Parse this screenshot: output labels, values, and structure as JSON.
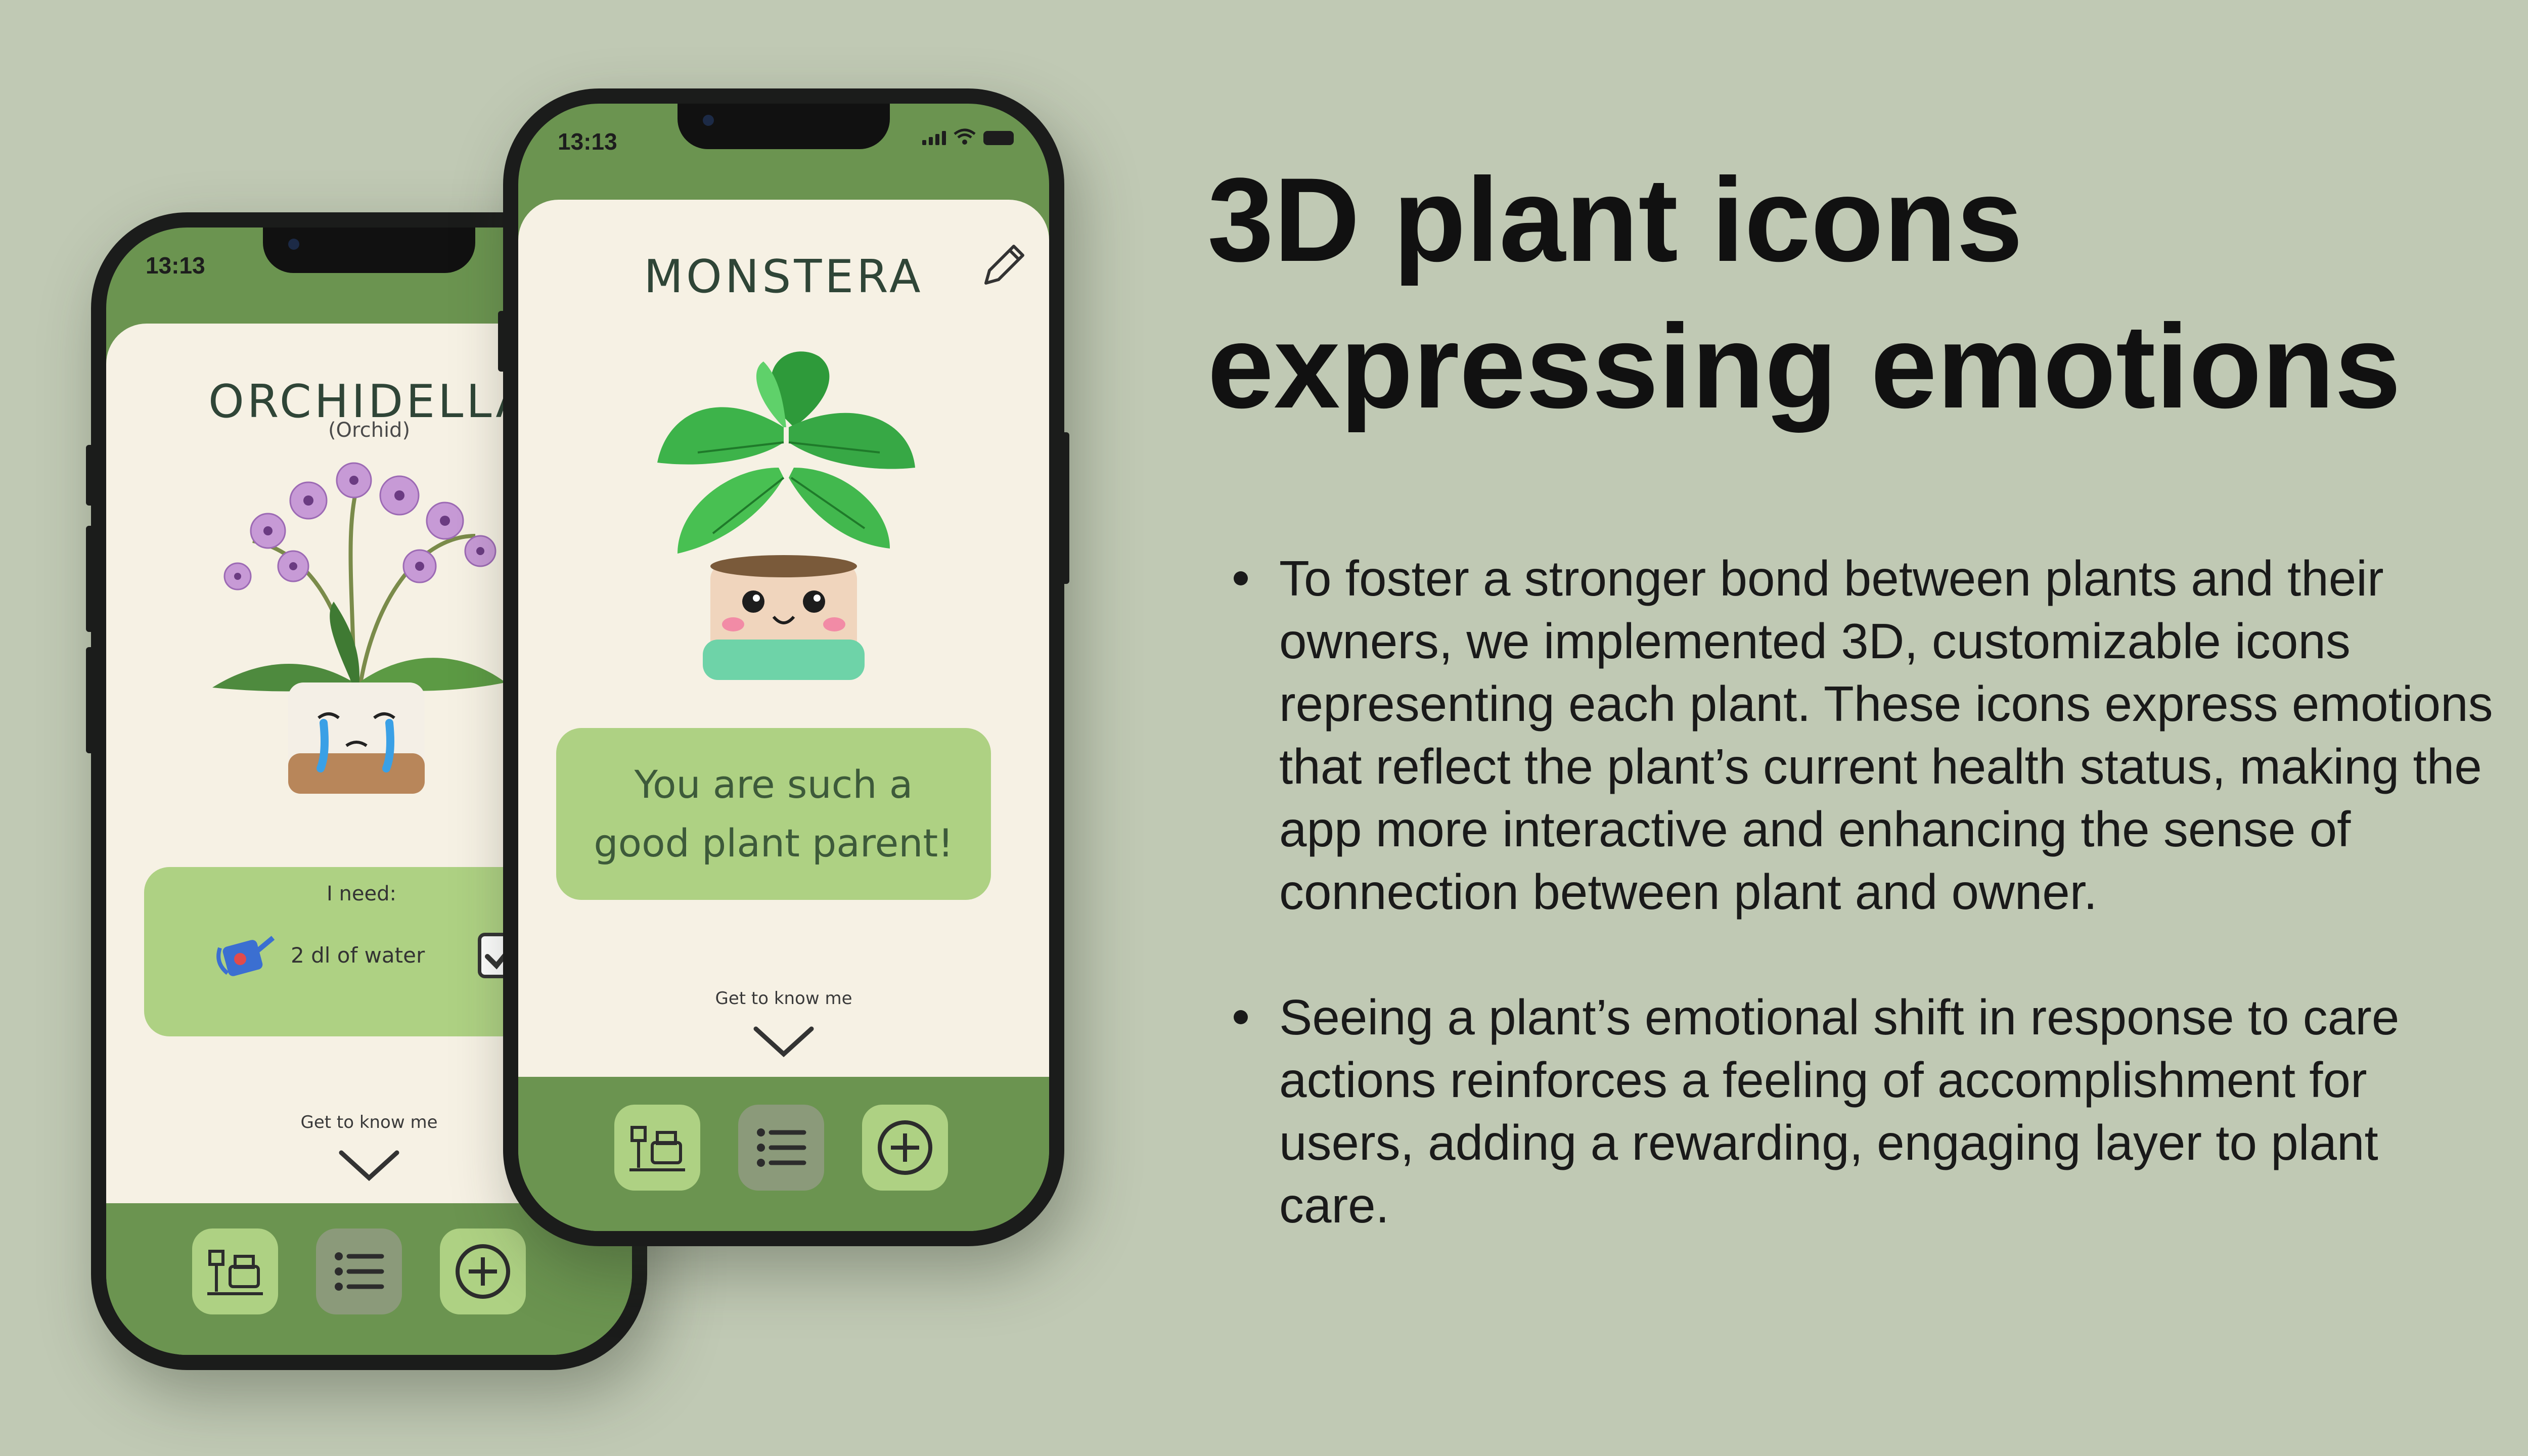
{
  "headline": {
    "line1": "3D plant icons",
    "line2": "expressing emotions"
  },
  "bullets": [
    "To foster a stronger bond between plants and their owners, we implemented 3D, customizable icons representing each plant. These icons express emotions that reflect the plant’s current health status, making the app more interactive and enhancing the sense of connection between plant and owner.",
    "Seeing a plant’s emotional shift in response to care actions reinforces a feeling of accomplishment for users, adding a rewarding, engaging layer to plant care."
  ],
  "back_phone": {
    "time": "13:13",
    "plant_name": "ORCHIDELLA",
    "plant_type": "(Orchid)",
    "needs_label": "I need:",
    "need_item": "2 dl of water",
    "get_to_know": "Get to know me",
    "mood": "crying",
    "nav": [
      "shelf-icon",
      "list-icon",
      "add-icon"
    ]
  },
  "front_phone": {
    "time": "13:13",
    "plant_name": "MONSTERA",
    "message": "You are such a good plant parent!",
    "get_to_know": "Get to know me",
    "mood": "happy",
    "nav": [
      "shelf-icon",
      "list-icon",
      "add-icon"
    ]
  },
  "colors": {
    "background": "#c0c9b4",
    "app_green": "#6b9450",
    "light_green": "#aed183",
    "card_cream": "#f6f1e4"
  }
}
